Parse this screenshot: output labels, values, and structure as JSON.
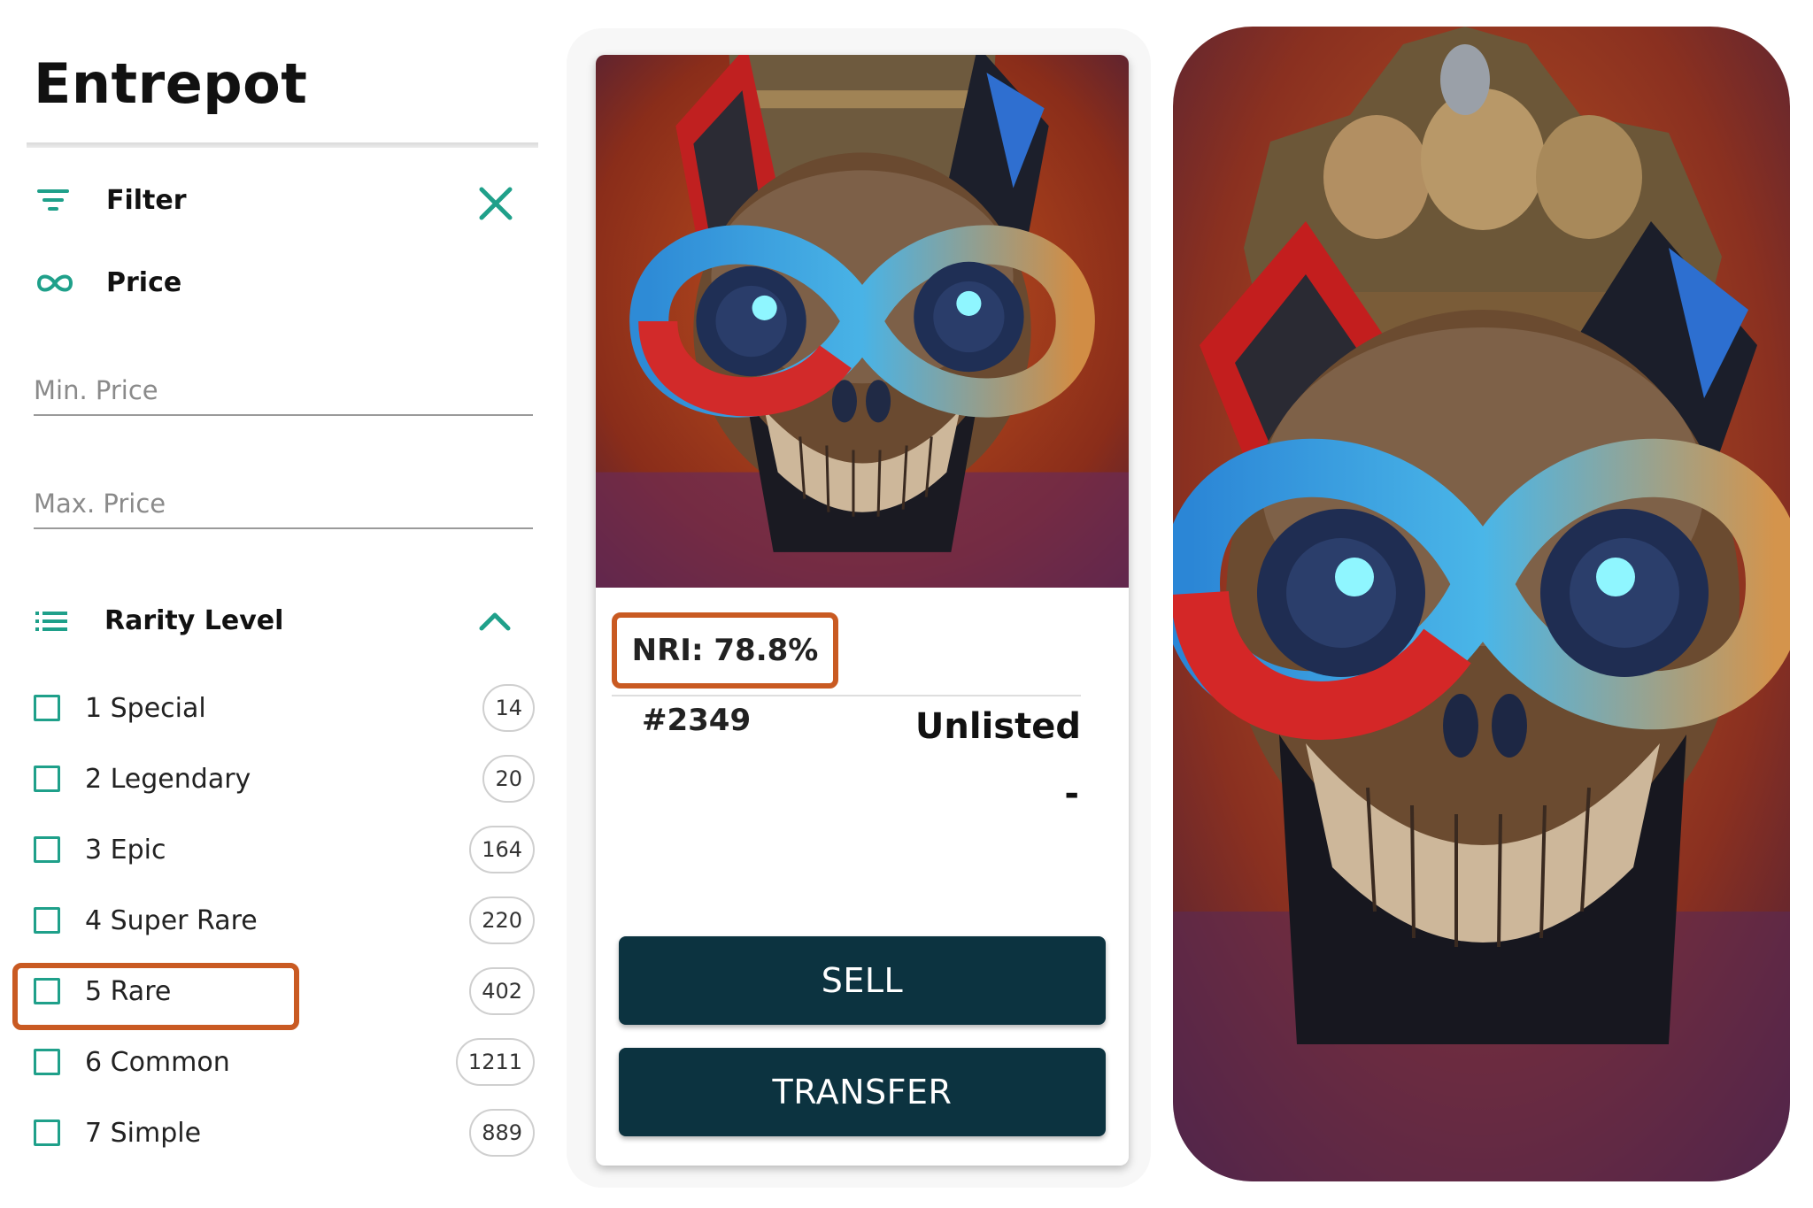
{
  "sidebar": {
    "brand": "Entrepot",
    "filter_label": "Filter",
    "price_label": "Price",
    "min_price_placeholder": "Min. Price",
    "max_price_placeholder": "Max. Price",
    "rarity_label": "Rarity Level",
    "rarity_items": [
      {
        "label": "1 Special",
        "count": "14"
      },
      {
        "label": "2 Legendary",
        "count": "20"
      },
      {
        "label": "3 Epic",
        "count": "164"
      },
      {
        "label": "4 Super Rare",
        "count": "220"
      },
      {
        "label": "5 Rare",
        "count": "402"
      },
      {
        "label": "6 Common",
        "count": "1211"
      },
      {
        "label": "7 Simple",
        "count": "889"
      }
    ],
    "highlighted_item": "5 Rare"
  },
  "card": {
    "nri": "NRI: 78.8%",
    "token_id": "#2349",
    "status": "Unlisted",
    "price": "-",
    "sell_label": "SELL",
    "transfer_label": "TRANSFER"
  },
  "colors": {
    "accent": "#1fa08a",
    "highlight": "#c95a22",
    "button": "#0c3340"
  },
  "icons": {
    "filter": "filter-lines-icon",
    "price": "infinity-icon",
    "close": "close-icon",
    "rarity": "list-icon",
    "collapse": "chevron-up-icon"
  }
}
